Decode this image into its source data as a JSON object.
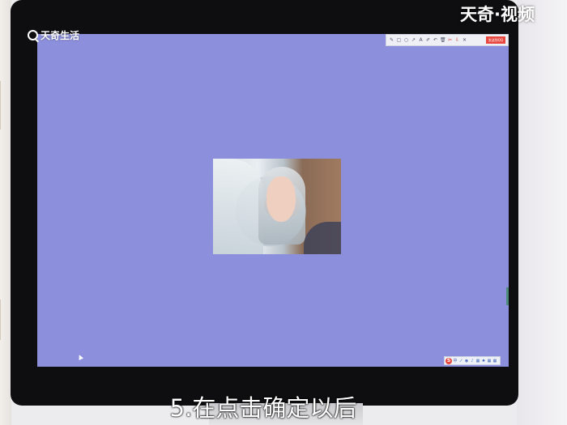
{
  "overlay": {
    "brand_text": "天奇生活",
    "watermark": "天奇·视频",
    "subtitle": "5.在点击确定以后"
  },
  "editor_toolbar": {
    "icons": [
      "pencil-icon",
      "rectangle-icon",
      "circle-icon",
      "arrow-icon",
      "text-icon",
      "brush-icon",
      "undo-icon",
      "delete-icon",
      "pin-icon",
      "save-icon",
      "close-icon"
    ],
    "glyphs": [
      "✎",
      "▢",
      "○",
      "↗",
      "A",
      "✐",
      "↶",
      "🗑",
      "✂",
      "⇩",
      "✕"
    ],
    "action_label": "发送到QQ"
  },
  "ime_bar": {
    "logo": "S",
    "glyphs": [
      "中",
      "ノ",
      "◉",
      "♪",
      "▦",
      "♠",
      "▦",
      "▦"
    ]
  },
  "colors": {
    "screen_background": "#8b8fdc",
    "toolbar_action": "#e8473f",
    "bezel": "#0e0e10"
  }
}
